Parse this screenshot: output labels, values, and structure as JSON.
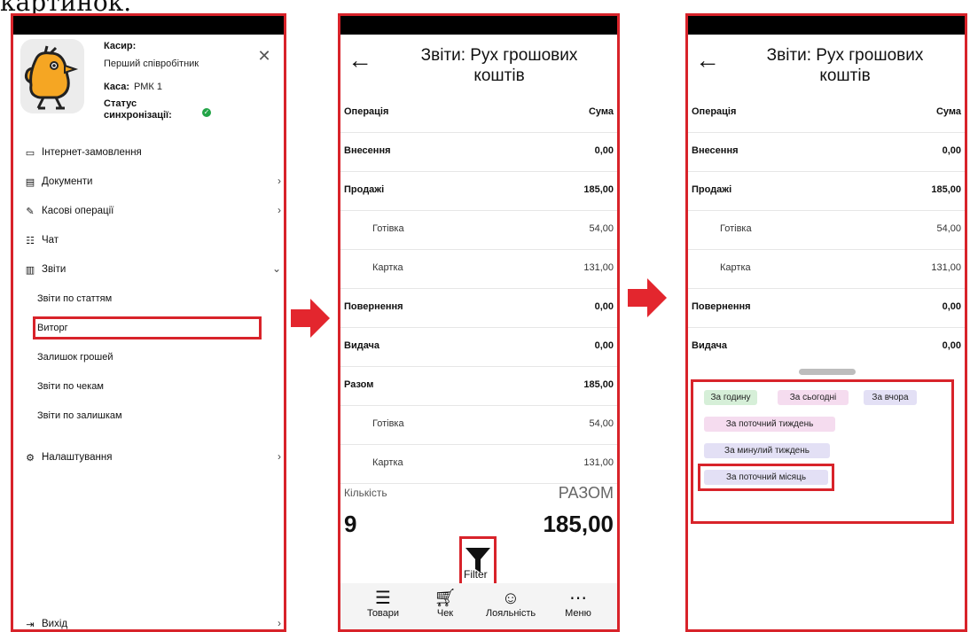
{
  "caption": "картинок.",
  "colors": {
    "highlight": "#d8232a",
    "sync_ok": "#22a447",
    "chip_green": "#d6efd8",
    "chip_pink": "#f5dcef",
    "chip_lavender": "#e3e0f5"
  },
  "menu": {
    "cashier_label": "Касир:",
    "cashier_value": "Перший співробітник",
    "register_label": "Каса:",
    "register_value": "РМК 1",
    "sync_label_1": "Статус",
    "sync_label_2": "синхронізації:",
    "items": [
      {
        "label": "Інтернет-замовлення",
        "icon": "laptop-icon"
      },
      {
        "label": "Документи",
        "icon": "document-icon"
      },
      {
        "label": "Касові операції",
        "icon": "cash-operations-icon"
      },
      {
        "label": "Чат",
        "icon": "chat-icon"
      },
      {
        "label": "Звіти",
        "icon": "reports-icon"
      }
    ],
    "report_subitems": [
      "Звіти по статтям",
      "Виторг",
      "Залишок грошей",
      "Звіти по чекам",
      "Звіти по залишкам"
    ],
    "settings_label": "Налаштування",
    "exit_label": "Вихід"
  },
  "report": {
    "title_line1": "Звіти: Рух грошових",
    "title_line2": "коштів",
    "col_operation": "Операція",
    "col_sum": "Сума",
    "rows": [
      {
        "label": "Внесення",
        "value": "0,00"
      },
      {
        "label": "Продажі",
        "value": "185,00"
      },
      {
        "label": "Готівка",
        "value": "54,00"
      },
      {
        "label": "Картка",
        "value": "131,00"
      },
      {
        "label": "Повернення",
        "value": "0,00"
      },
      {
        "label": "Видача",
        "value": "0,00"
      },
      {
        "label": "Разом",
        "value": "185,00"
      },
      {
        "label": "Готівка",
        "value": "54,00"
      },
      {
        "label": "Картка",
        "value": "131,00"
      }
    ],
    "count_label": "Кількість",
    "count_value": "9",
    "total_label": "РАЗОМ",
    "total_value": "185,00",
    "filter_label": "Filter",
    "nav": [
      "Товари",
      "Чек",
      "Лояльність",
      "Меню"
    ]
  },
  "filters": {
    "chips": [
      "За годину",
      "За сьогодні",
      "За вчора",
      "За поточний тиждень",
      "За минулий тиждень",
      "За поточний місяць"
    ]
  }
}
